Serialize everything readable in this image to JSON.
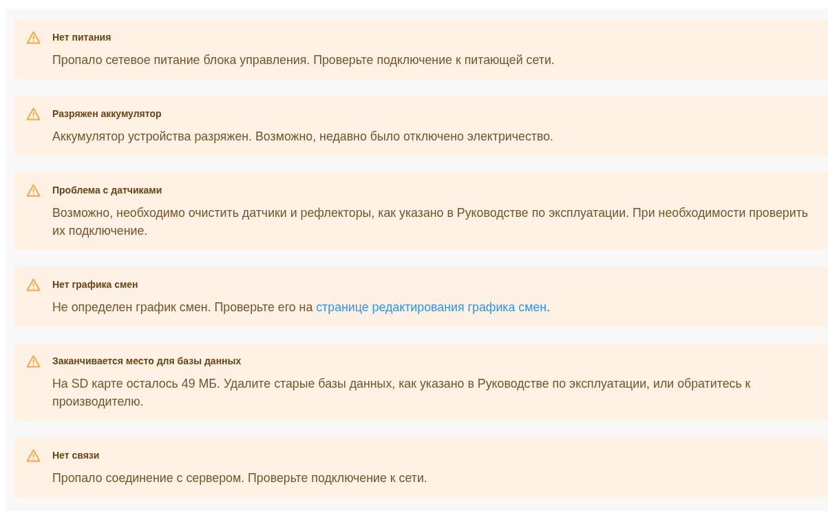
{
  "alerts": [
    {
      "title": "Нет питания",
      "body": [
        {
          "kind": "text",
          "text": "Пропало сетевое питание блока управления. Проверьте подключение к питающей сети."
        }
      ]
    },
    {
      "title": "Разряжен аккумулятор",
      "body": [
        {
          "kind": "text",
          "text": "Аккумулятор устройства разряжен. Возможно, недавно было отключено электричество."
        }
      ]
    },
    {
      "title": "Проблема с датчиками",
      "body": [
        {
          "kind": "text",
          "text": "Возможно, необходимо очистить датчики и рефлекторы, как указано в Руководстве по эксплуатации. При необходимости проверить их подключение."
        }
      ]
    },
    {
      "title": "Нет графика смен",
      "body": [
        {
          "kind": "text",
          "text": "Не определен график смен. Проверьте его на "
        },
        {
          "kind": "link",
          "text": "странице редактирования графика смен"
        },
        {
          "kind": "text",
          "text": "."
        }
      ]
    },
    {
      "title": "Заканчивается место для базы данных",
      "body": [
        {
          "kind": "text",
          "text": "На SD карте осталось 49 МБ. Удалите старые базы данных, как указано в Руководстве по эксплуатации, или обратитесь к производителю."
        }
      ]
    },
    {
      "title": "Нет связи",
      "body": [
        {
          "kind": "text",
          "text": "Пропало соединение с сервером. Проверьте подключение к сети."
        }
      ]
    }
  ]
}
